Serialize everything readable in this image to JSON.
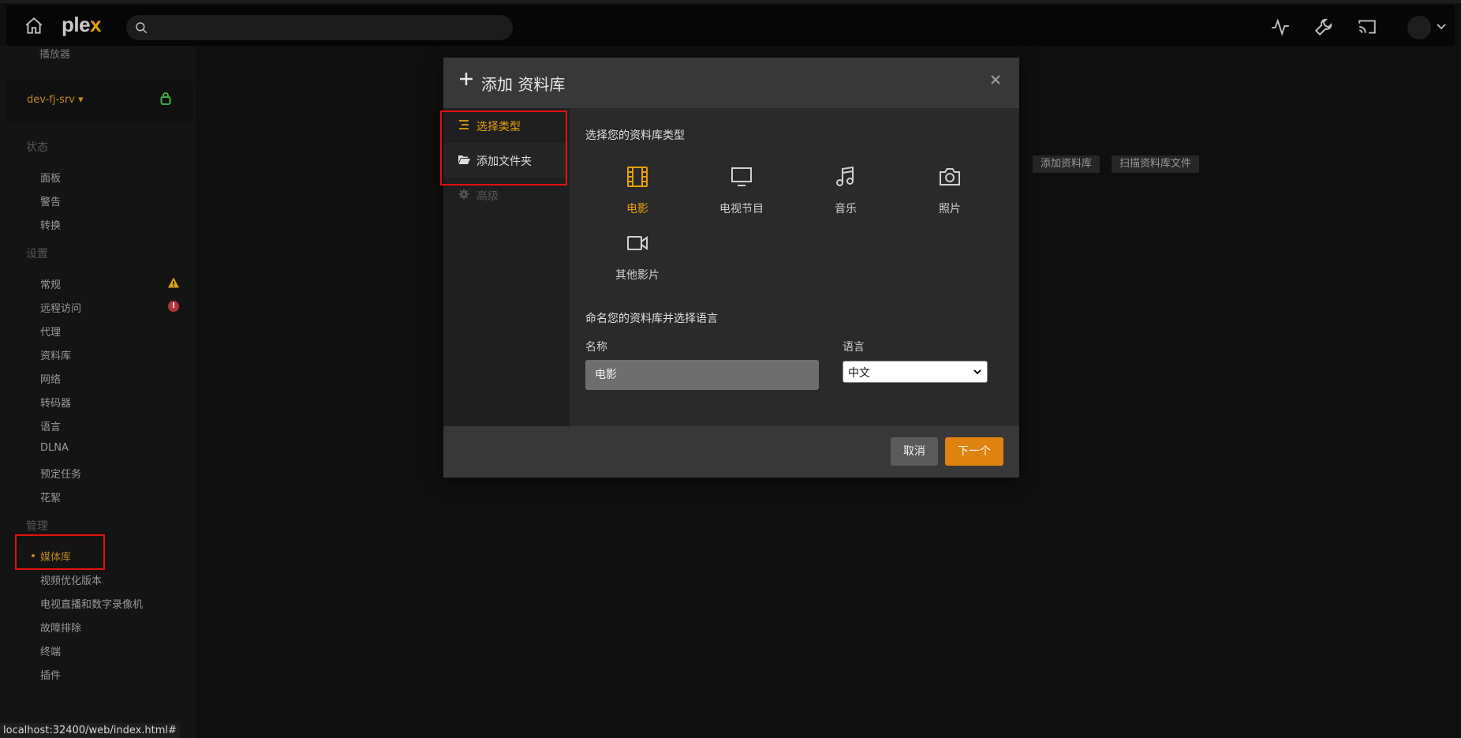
{
  "app": {
    "logo_main": "ple",
    "logo_x": "x"
  },
  "topbar": {
    "search_placeholder": ""
  },
  "sidebar": {
    "partial_top_label": "播放器",
    "server_name": "dev-fj-srv",
    "sections": [
      {
        "title": "状态",
        "items": [
          "面板",
          "警告",
          "转换"
        ]
      },
      {
        "title": "设置",
        "items": [
          "常规",
          "远程访问",
          "代理",
          "资料库",
          "网络",
          "转码器",
          "语言",
          "DLNA",
          "预定任务",
          "花絮"
        ]
      },
      {
        "title": "管理",
        "items": [
          "媒体库",
          "视频优化版本",
          "电视直播和数字录像机",
          "故障排除",
          "终端",
          "插件"
        ]
      }
    ],
    "active_item": "媒体库"
  },
  "background_buttons": {
    "add_library": "添加资料库",
    "scan_library": "扫描资料库文件"
  },
  "modal": {
    "title": "添加 资料库",
    "nav": [
      {
        "label": "选择类型",
        "icon": "list-icon",
        "state": "selected"
      },
      {
        "label": "添加文件夹",
        "icon": "folder-open-icon",
        "state": "normal"
      },
      {
        "label": "高级",
        "icon": "gear-icon",
        "state": "disabled"
      }
    ],
    "type_heading": "选择您的资料库类型",
    "types": [
      {
        "label": "电影",
        "icon": "film-icon",
        "selected": true
      },
      {
        "label": "电视节目",
        "icon": "tv-icon",
        "selected": false
      },
      {
        "label": "音乐",
        "icon": "music-note-icon",
        "selected": false
      },
      {
        "label": "照片",
        "icon": "camera-icon",
        "selected": false
      },
      {
        "label": "其他影片",
        "icon": "video-camera-icon",
        "selected": false
      }
    ],
    "name_heading": "命名您的资料库并选择语言",
    "name_label": "名称",
    "name_value": "电影",
    "language_label": "语言",
    "language_value": "中文",
    "cancel_label": "取消",
    "next_label": "下一个"
  },
  "statusbar": {
    "url": "localhost:32400/web/index.html#"
  },
  "colors": {
    "accent": "#e5a00d",
    "highlight_box": "#e01010",
    "next_button": "#e0820f"
  }
}
